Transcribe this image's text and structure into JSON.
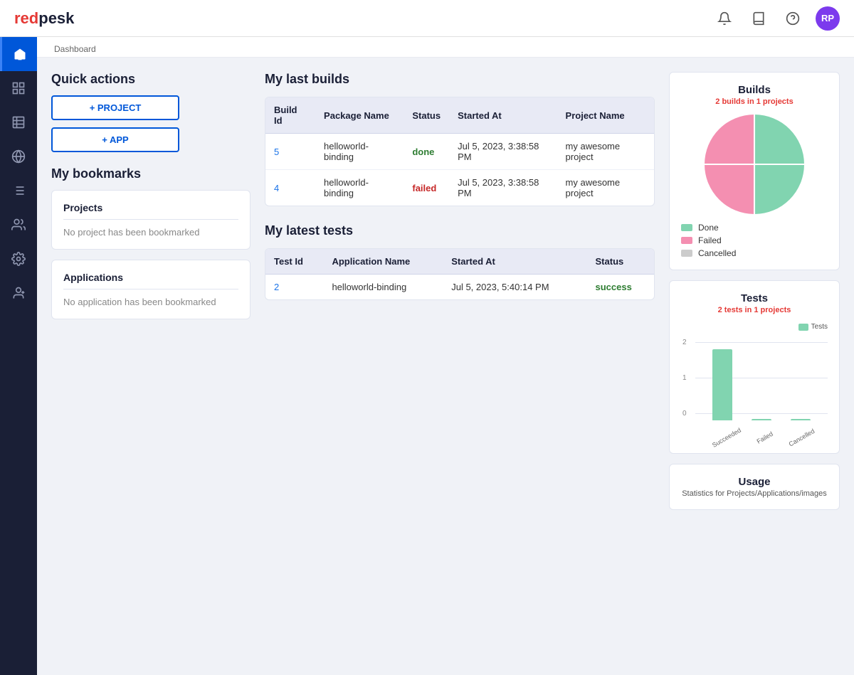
{
  "topbar": {
    "logo_red": "red",
    "logo_dark": "pesk",
    "avatar_initials": "RP"
  },
  "breadcrumb": "Dashboard",
  "sidebar": {
    "items": [
      {
        "label": "Home",
        "icon": "home",
        "active": true
      },
      {
        "label": "Grid",
        "icon": "grid"
      },
      {
        "label": "Table",
        "icon": "table"
      },
      {
        "label": "Globe",
        "icon": "globe"
      },
      {
        "label": "List",
        "icon": "list"
      },
      {
        "label": "Users",
        "icon": "users"
      },
      {
        "label": "Settings",
        "icon": "settings"
      },
      {
        "label": "User Settings",
        "icon": "user-settings"
      }
    ]
  },
  "quick_actions": {
    "title": "Quick actions",
    "btn_project": "+ PROJECT",
    "btn_app": "+ APP"
  },
  "bookmarks": {
    "title": "My bookmarks",
    "projects": {
      "title": "Projects",
      "empty_text": "No project has been bookmarked"
    },
    "applications": {
      "title": "Applications",
      "empty_text": "No application has been bookmarked"
    }
  },
  "last_builds": {
    "title": "My last builds",
    "columns": [
      "Build Id",
      "Package Name",
      "Status",
      "Started At",
      "Project Name"
    ],
    "rows": [
      {
        "build_id": "5",
        "package_name": "helloworld-binding",
        "status": "done",
        "started_at": "Jul 5, 2023, 3:38:58 PM",
        "project_name": "my awesome project"
      },
      {
        "build_id": "4",
        "package_name": "helloworld-binding",
        "status": "failed",
        "started_at": "Jul 5, 2023, 3:38:58 PM",
        "project_name": "my awesome project"
      }
    ]
  },
  "latest_tests": {
    "title": "My latest tests",
    "columns": [
      "Test Id",
      "Application Name",
      "Started At",
      "Status"
    ],
    "rows": [
      {
        "test_id": "2",
        "application_name": "helloworld-binding",
        "started_at": "Jul 5, 2023, 5:40:14 PM",
        "status": "success"
      }
    ]
  },
  "charts": {
    "builds": {
      "title": "Builds",
      "subtitle_prefix": "2 builds in ",
      "subtitle_highlight": "1",
      "subtitle_suffix": " projects",
      "done_pct": 50,
      "failed_pct": 50,
      "legend": [
        {
          "label": "Done",
          "color": "#81d4b0"
        },
        {
          "label": "Failed",
          "color": "#f48fb1"
        },
        {
          "label": "Cancelled",
          "color": "#ccc"
        }
      ]
    },
    "tests": {
      "title": "Tests",
      "subtitle_prefix": "2 tests in ",
      "subtitle_highlight": "1",
      "subtitle_suffix": " projects",
      "bar_legend_label": "Tests",
      "bar_color": "#81d4b0",
      "bars": [
        {
          "label": "Succeeded",
          "value": 2,
          "max": 2
        },
        {
          "label": "Failed",
          "value": 0,
          "max": 2
        },
        {
          "label": "Cancelled",
          "value": 0,
          "max": 2
        }
      ],
      "y_labels": [
        "2",
        "1",
        "0"
      ]
    },
    "usage": {
      "title": "Usage",
      "subtitle": "Statistics for Projects/Applications/images"
    }
  }
}
